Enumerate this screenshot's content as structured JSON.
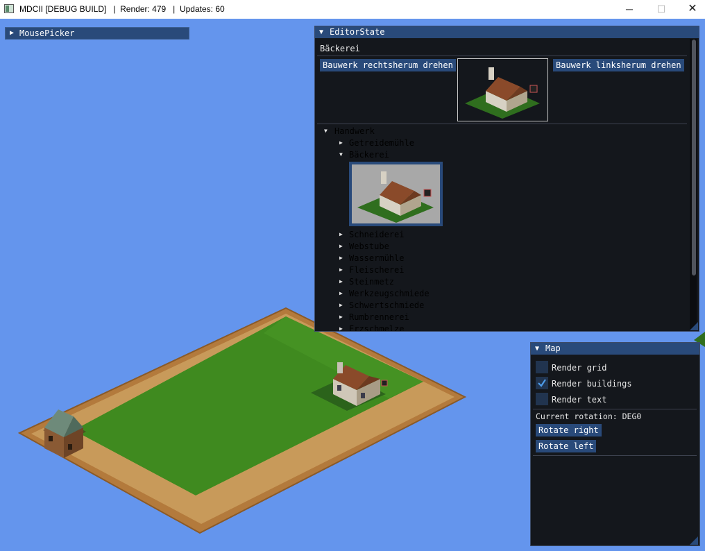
{
  "window": {
    "title": "MDCII [DEBUG BUILD]   |  Render: 479   |  Updates: 60",
    "icon": "app-icon",
    "controls": {
      "minimize": "─",
      "maximize": "☐",
      "close": "✕"
    }
  },
  "mouse_picker": {
    "title": "MousePicker",
    "collapsed": true
  },
  "editor": {
    "title": "EditorState",
    "selected_building": "Bäckerei",
    "rotate_right_label": "Bauwerk rechtsherum drehen",
    "rotate_left_label": "Bauwerk linksherum drehen",
    "tree": {
      "category": "Handwerk",
      "items": [
        {
          "label": "Getreidemühle",
          "open": false
        },
        {
          "label": "Bäckerei",
          "open": true
        },
        {
          "label": "Schneiderei",
          "open": false
        },
        {
          "label": "Webstube",
          "open": false
        },
        {
          "label": "Wassermühle",
          "open": false
        },
        {
          "label": "Fleischerei",
          "open": false
        },
        {
          "label": "Steinmetz",
          "open": false
        },
        {
          "label": "Werkzeugschmiede",
          "open": false
        },
        {
          "label": "Schwertschmiede",
          "open": false
        },
        {
          "label": "Rumbrennerei",
          "open": false
        },
        {
          "label": "Erzschmelze",
          "open": false
        }
      ]
    }
  },
  "map": {
    "title": "Map",
    "render_grid_label": "Render grid",
    "render_grid": false,
    "render_buildings_label": "Render buildings",
    "render_buildings": true,
    "render_text_label": "Render text",
    "render_text": false,
    "current_rotation": "Current rotation: DEG0",
    "rotate_right_label": "Rotate right",
    "rotate_left_label": "Rotate left"
  },
  "colors": {
    "background": "#6495ed",
    "panel": "#14171c",
    "accent": "#294a7a",
    "grass": "#3f8a1f",
    "check": "#4d9be8"
  }
}
